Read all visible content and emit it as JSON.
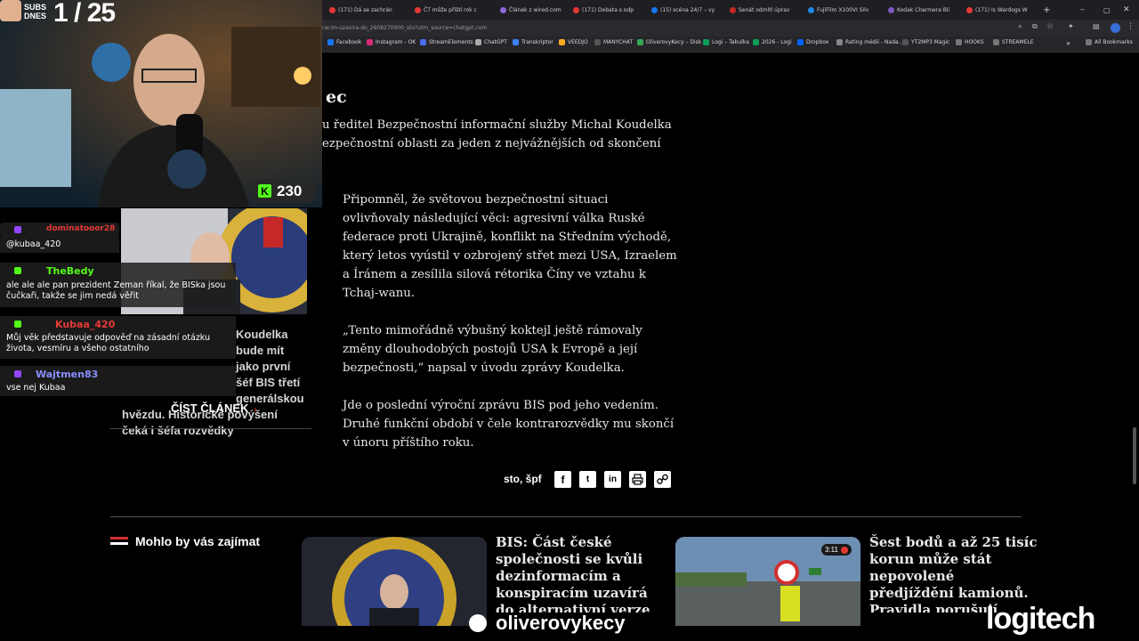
{
  "stream": {
    "subs_label": "SUBS DNES",
    "subs_count": "1 / 25",
    "kick_viewers": "230",
    "channel": "oliverovykecy",
    "sponsor": "logitech"
  },
  "browser": {
    "tabs": [
      {
        "label": "(171) Dá se zachrán",
        "color": "#e53935"
      },
      {
        "label": "ČT může příští rok c",
        "color": "#e53935"
      },
      {
        "label": "Článek z wired.com",
        "color": "#8e6ad8"
      },
      {
        "label": "(171) Debata s odp",
        "color": "#e53935"
      },
      {
        "label": "(15) scéna 24/7 – vy",
        "color": "#1877f2"
      },
      {
        "label": "Senát odmítl úprav",
        "color": "#c62828"
      },
      {
        "label": "FujiFilm X100VI Silv",
        "color": "#1e88e5"
      },
      {
        "label": "Kodak Charmera Bli",
        "color": "#7e57c2"
      },
      {
        "label": "(171) Is Wardogs W",
        "color": "#e53935"
      }
    ],
    "url": "racim-uzavira-do_2608270900_sto?utm_source=chatgpt.com",
    "bookmarks": [
      {
        "label": "Facebook",
        "color": "#1877f2"
      },
      {
        "label": "Instagram - OK",
        "color": "#d62976"
      },
      {
        "label": "StreamElements",
        "color": "#4b6ef5"
      },
      {
        "label": "ChatGPT",
        "color": "#aaaaaa"
      },
      {
        "label": "Transkriptor",
        "color": "#3b82f6"
      },
      {
        "label": "VEEDJO",
        "color": "#f9a825"
      },
      {
        "label": "MANYCHAT",
        "color": "#333333"
      },
      {
        "label": "OliverovyKecy – Disk",
        "color": "#34a853"
      },
      {
        "label": "Logi – Tabulka",
        "color": "#0f9d58"
      },
      {
        "label": "2026 - Logi",
        "color": "#0f9d58"
      },
      {
        "label": "Dropbox",
        "color": "#0061fe"
      },
      {
        "label": "Rating médií - Nada...",
        "color": "#888888"
      },
      {
        "label": "YT2MP3 Magic",
        "color": "#333333"
      },
      {
        "label": "HOOKS",
        "color": "#555555"
      },
      {
        "label": "STREAMELE",
        "color": "#555555"
      }
    ],
    "all_bookmarks": "All Bookmarks"
  },
  "article": {
    "heading_fragment": "ec",
    "intro_lines": [
      "u ředitel Bezpečnostní informační služby Michal Koudelka",
      "ezpečnostní oblasti za jeden z nejvážnějších od skončení"
    ],
    "paragraphs": [
      [
        "Připomněl, že světovou bezpečnostní situaci",
        "ovlivňovaly následující věci: agresivní válka Ruské",
        "federace proti Ukrajině, konflikt na Středním východě,",
        "který letos vyústil v ozbrojený střet mezi USA, Izraelem",
        "a Íránem a zesílila silová rétorika Číny ve vztahu k",
        "Tchaj-wanu."
      ],
      [
        "„Tento mimořádně výbušný koktejl ještě rámovaly",
        "změny dlouhodobých postojů USA k Evropě a její",
        "bezpečnosti,“ napsal v úvodu zprávy Koudelka."
      ],
      [
        "Jde o poslední výroční zprávu BIS pod jeho vedením.",
        "Druhé funkční období v čele kontrarozvědky mu skončí",
        "v únoru příštího roku."
      ]
    ],
    "author": "sto, špf",
    "share_icons": [
      "f",
      "t",
      "in",
      "print",
      "link"
    ]
  },
  "sidebar_card": {
    "text_lines": [
      "Koudelka bude mít jako první",
      "šéf BIS třetí generálskou",
      "hvězdu. Historické povýšení",
      "čeká i šéfa rozvědky"
    ],
    "read_label": "ČÍST ČLÁNEK"
  },
  "related": {
    "heading": "Mohlo by vás zajímat",
    "items": [
      {
        "title": [
          "BIS: Část české",
          "společnosti se kvůli",
          "dezinformacím a",
          "konspiracím uzavírá",
          "do alternativní verze"
        ]
      },
      {
        "title": [
          "Šest bodů a až 25 tisíc",
          "korun může stát",
          "nepovolené",
          "předjíždění kamionů.",
          "Pravidla porušují"
        ],
        "duration": "3:11"
      }
    ]
  },
  "chat": [
    {
      "user": "dominatooor28",
      "color": "#e53935",
      "text": "@kubaa_420"
    },
    {
      "user": "TheBedy",
      "color": "#53fc18",
      "text": "ale ale ale pan prezident Zeman říkal, že BISka jsou čučkaři, takže se jim nedá věřit"
    },
    {
      "user": "Kubaa_420",
      "color": "#e53935",
      "text": "Můj věk představuje odpověď na zásadní otázku života, vesmíru a všeho ostatního"
    },
    {
      "user": "Wajtmen83",
      "color": "#8a8fff",
      "text": "vse nej Kubaa"
    }
  ]
}
